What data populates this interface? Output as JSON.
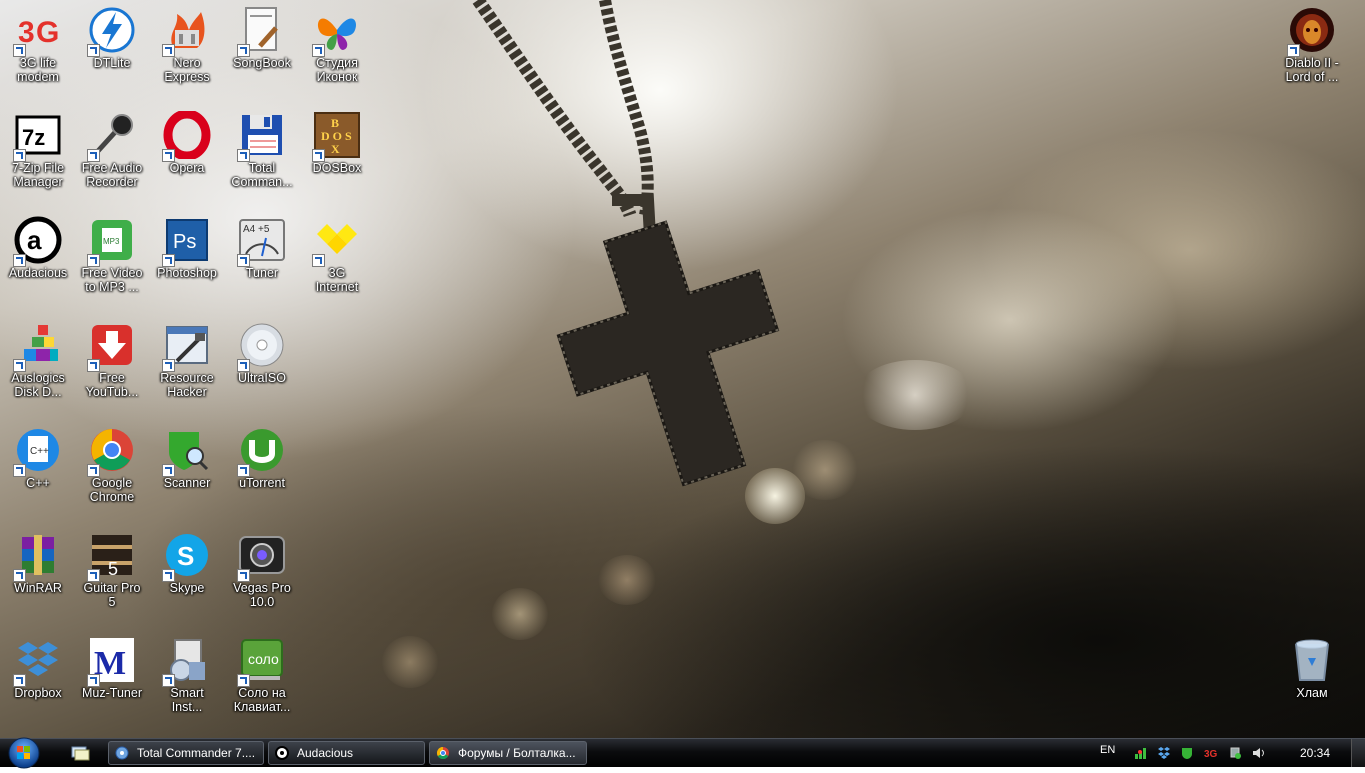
{
  "desktop": {
    "icons": [
      {
        "id": "3g-life-modem",
        "label": "3G life\nmodem",
        "icon": "3g-logo-icon"
      },
      {
        "id": "dtlite",
        "label": "DTLite",
        "icon": "daemon-lightning-icon"
      },
      {
        "id": "nero-express",
        "label": "Nero\nExpress",
        "icon": "nero-flame-icon"
      },
      {
        "id": "songbook",
        "label": "SongBook",
        "icon": "songbook-icon"
      },
      {
        "id": "studio-ikonok",
        "label": "Студия\nИконок",
        "icon": "butterfly-icon"
      },
      {
        "id": "7zip",
        "label": "7-Zip File\nManager",
        "icon": "7zip-icon"
      },
      {
        "id": "free-audio-recorder",
        "label": "Free Audio\nRecorder",
        "icon": "microphone-icon"
      },
      {
        "id": "opera",
        "label": "Opera",
        "icon": "opera-icon"
      },
      {
        "id": "total-commander",
        "label": "Total\nComman...",
        "icon": "floppy-disk-icon"
      },
      {
        "id": "dosbox",
        "label": "DOSBox",
        "icon": "dosbox-icon"
      },
      {
        "id": "audacious",
        "label": "Audacious",
        "icon": "audacious-icon"
      },
      {
        "id": "free-video-to-mp3",
        "label": "Free Video\nto MP3 ...",
        "icon": "mp3-converter-icon"
      },
      {
        "id": "photoshop",
        "label": "Photoshop",
        "icon": "photoshop-icon"
      },
      {
        "id": "tuner",
        "label": "Tuner",
        "icon": "tuner-icon"
      },
      {
        "id": "3g-internet",
        "label": "3G\nInternet",
        "icon": "3g-internet-icon"
      },
      {
        "id": "auslogics",
        "label": "Auslogics\nDisk D...",
        "icon": "defrag-blocks-icon"
      },
      {
        "id": "free-youtube",
        "label": "Free\nYouTub...",
        "icon": "download-arrow-icon"
      },
      {
        "id": "resource-hacker",
        "label": "Resource\nHacker",
        "icon": "resource-hacker-icon"
      },
      {
        "id": "ultraiso",
        "label": "UltraISO",
        "icon": "cd-disc-icon"
      },
      {
        "id": "cpp",
        "label": "C++",
        "icon": "cpp-icon"
      },
      {
        "id": "google-chrome",
        "label": "Google\nChrome",
        "icon": "chrome-icon"
      },
      {
        "id": "scanner",
        "label": "Scanner",
        "icon": "scanner-shield-icon"
      },
      {
        "id": "utorrent",
        "label": "uTorrent",
        "icon": "utorrent-icon"
      },
      {
        "id": "winrar",
        "label": "WinRAR",
        "icon": "winrar-icon"
      },
      {
        "id": "guitar-pro",
        "label": "Guitar Pro\n5",
        "icon": "guitar-pro-icon"
      },
      {
        "id": "skype",
        "label": "Skype",
        "icon": "skype-icon"
      },
      {
        "id": "vegas-pro",
        "label": "Vegas Pro\n10.0",
        "icon": "vegas-camera-icon"
      },
      {
        "id": "dropbox",
        "label": "Dropbox",
        "icon": "dropbox-icon"
      },
      {
        "id": "muz-tuner",
        "label": "Muz-Tuner",
        "icon": "muz-tuner-icon"
      },
      {
        "id": "smart-install",
        "label": "Smart\nInst...",
        "icon": "installer-icon"
      },
      {
        "id": "solo-keyboard",
        "label": "Соло на\nКлавиат...",
        "icon": "solo-icon"
      },
      {
        "id": "diablo-ii",
        "label": "Diablo II -\nLord of ...",
        "icon": "diablo-icon"
      },
      {
        "id": "recycle-bin",
        "label": "Хлам",
        "icon": "recycle-bin-icon"
      }
    ]
  },
  "taskbar": {
    "start": {
      "icon": "windows-orb-icon"
    },
    "quick_launch": [
      {
        "icon": "show-desktop-icon"
      }
    ],
    "tasks": [
      {
        "label": "Total Commander 7....",
        "icon": "total-commander-icon"
      },
      {
        "label": "Audacious",
        "icon": "audacious-icon"
      },
      {
        "label": "Форумы / Болталка...",
        "icon": "chrome-icon"
      }
    ],
    "tray": {
      "language": "EN",
      "icons": [
        "network-icon",
        "dropbox-icon",
        "antivirus-icon",
        "3g-icon",
        "safely-remove-icon",
        "volume-icon"
      ],
      "clock": "20:34"
    }
  },
  "colors": {
    "taskbar_bg": "#0b0c0e",
    "label_text": "#ffffff",
    "opera_red": "#d9001b",
    "chrome_green": "#2ea043",
    "skype_blue": "#12a5e8",
    "photoshop_blue": "#1f5fa8"
  }
}
